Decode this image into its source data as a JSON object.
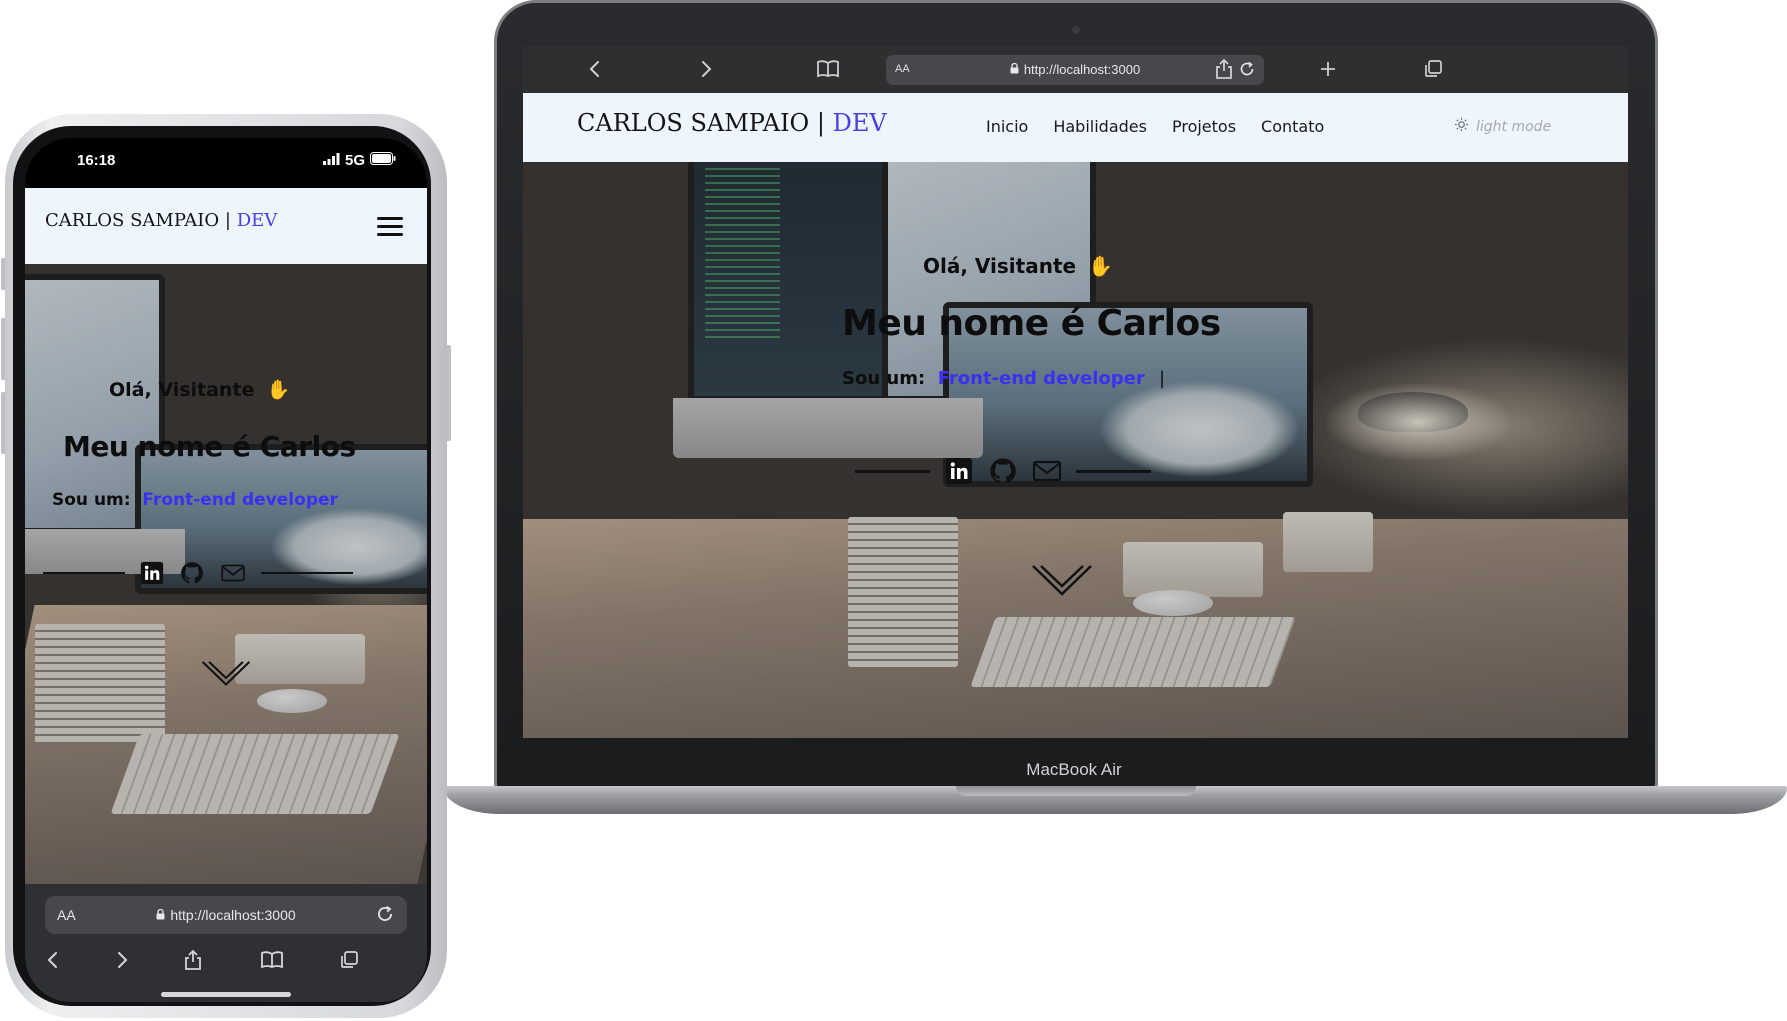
{
  "browser": {
    "url": "http://localhost:3000",
    "text_size_label": "AA",
    "icons": [
      "back-icon",
      "forward-icon",
      "bookmarks-icon",
      "lock-icon",
      "reload-icon",
      "share-icon",
      "new-tab-icon",
      "tabs-icon"
    ]
  },
  "site": {
    "brand_name": "CARLOS SAMPAIO",
    "brand_separator": "|",
    "brand_accent": "DEV",
    "nav_links": [
      "Inicio",
      "Habilidades",
      "Projetos",
      "Contato"
    ],
    "mode_toggle": "light mode",
    "accent_color": "#4b3ee6",
    "nav_background": "#eef5fd"
  },
  "hero": {
    "greeting": "Olá, Visitante",
    "greeting_emoji": "✋",
    "name_line": "Meu nome é Carlos",
    "role_prefix": "Sou um:",
    "role_value": "Front-end developer",
    "typing_cursor": "|",
    "social_icons": [
      "linkedin-icon",
      "github-icon",
      "mail-icon"
    ],
    "scroll_hint_icon": "chevron-down-icon"
  },
  "laptop": {
    "model_label": "MacBook Air"
  },
  "phone": {
    "time": "16:18",
    "network": "5G",
    "text_size_label": "AA"
  }
}
